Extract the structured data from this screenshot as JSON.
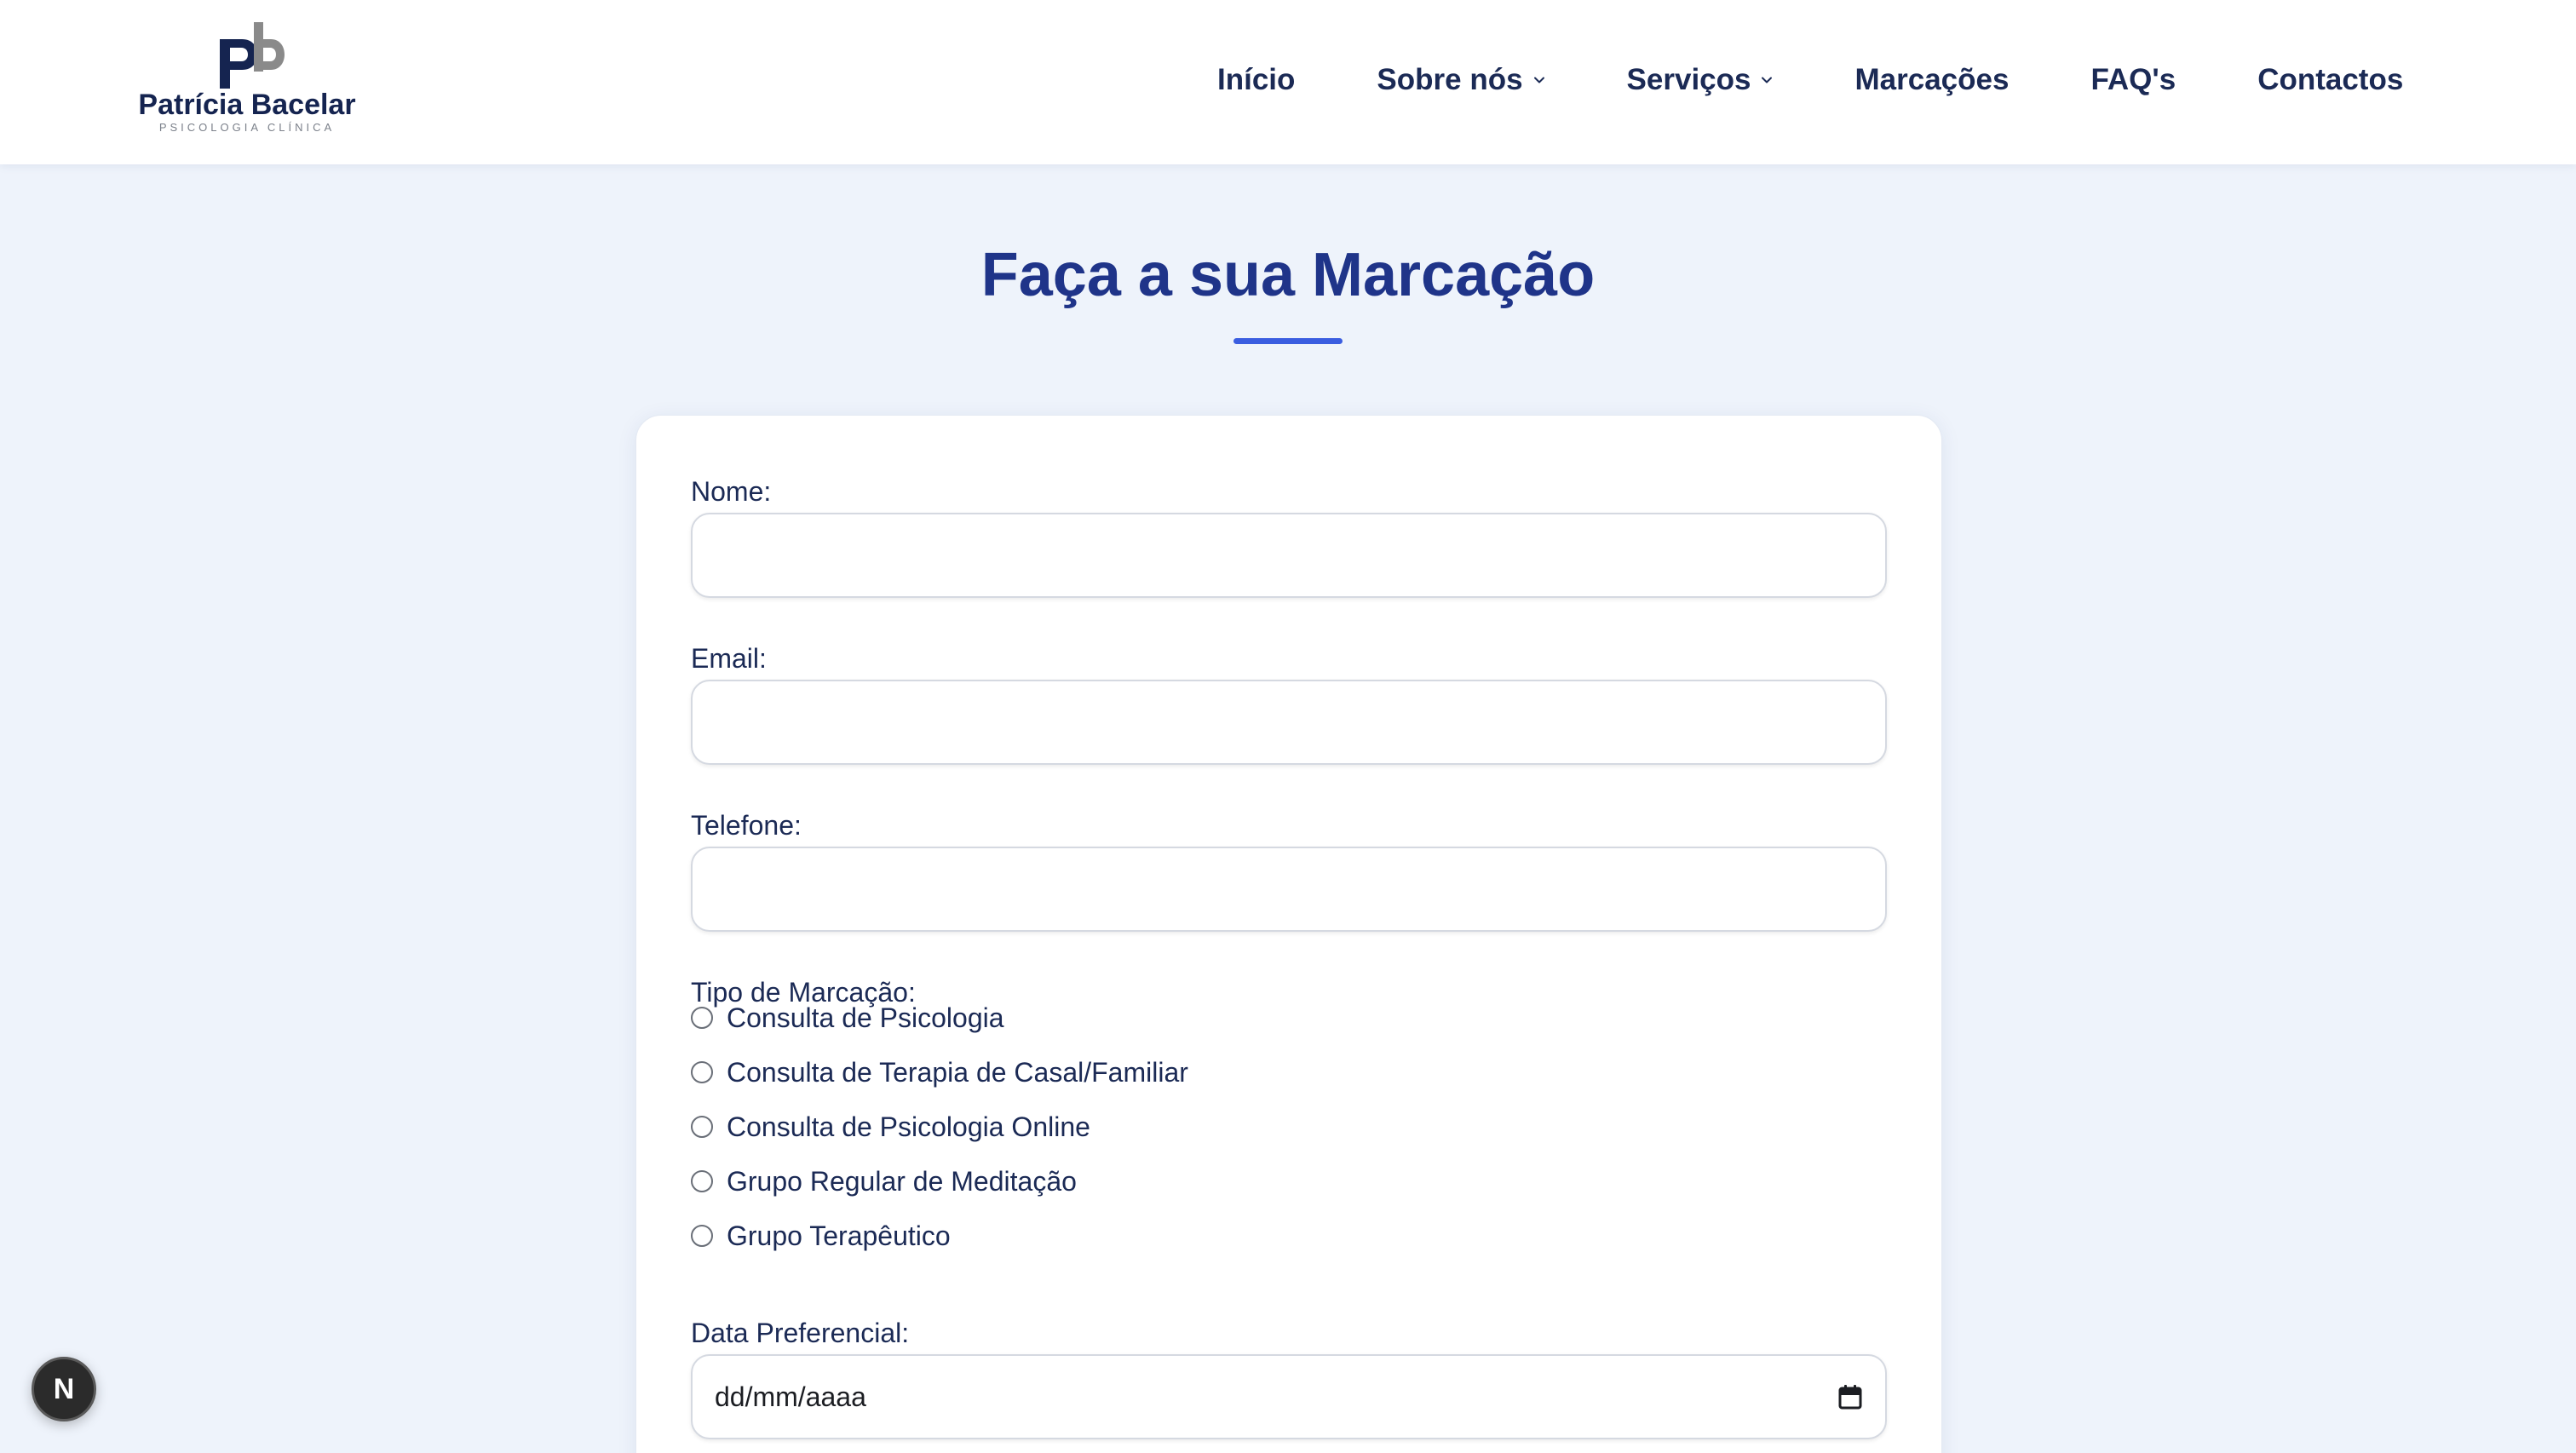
{
  "brand": {
    "mark": "pb",
    "name": "Patrícia Bacelar",
    "tagline": "PSICOLOGIA CLÍNICA",
    "colors": {
      "primary": "#152450",
      "secondary": "#8a8a8a"
    }
  },
  "nav": {
    "items": [
      {
        "label": "Início",
        "has_dropdown": false
      },
      {
        "label": "Sobre nós",
        "has_dropdown": true
      },
      {
        "label": "Serviços",
        "has_dropdown": true
      },
      {
        "label": "Marcações",
        "has_dropdown": false
      },
      {
        "label": "FAQ's",
        "has_dropdown": false
      },
      {
        "label": "Contactos",
        "has_dropdown": false
      }
    ]
  },
  "page": {
    "title": "Faça a sua Marcação",
    "accent_color": "#3a5de0",
    "title_color": "#1f3489",
    "background": "#eef3fb"
  },
  "form": {
    "fields": {
      "nome": {
        "label": "Nome:",
        "value": "",
        "placeholder": ""
      },
      "email": {
        "label": "Email:",
        "value": "",
        "placeholder": ""
      },
      "telefone": {
        "label": "Telefone:",
        "value": "",
        "placeholder": ""
      }
    },
    "tipo_marcacao": {
      "label": "Tipo de Marcação:",
      "options": [
        {
          "label": "Consulta de Psicologia",
          "selected": false
        },
        {
          "label": "Consulta de Terapia de Casal/Familiar",
          "selected": false
        },
        {
          "label": "Consulta de Psicologia Online",
          "selected": false
        },
        {
          "label": "Grupo Regular de Meditação",
          "selected": false
        },
        {
          "label": "Grupo Terapêutico",
          "selected": false
        }
      ]
    },
    "data_preferencial": {
      "label": "Data Preferencial:",
      "display_value": "dd/mm/aaaa",
      "icon": "calendar-icon"
    }
  },
  "floating_badge": {
    "label": "N"
  }
}
